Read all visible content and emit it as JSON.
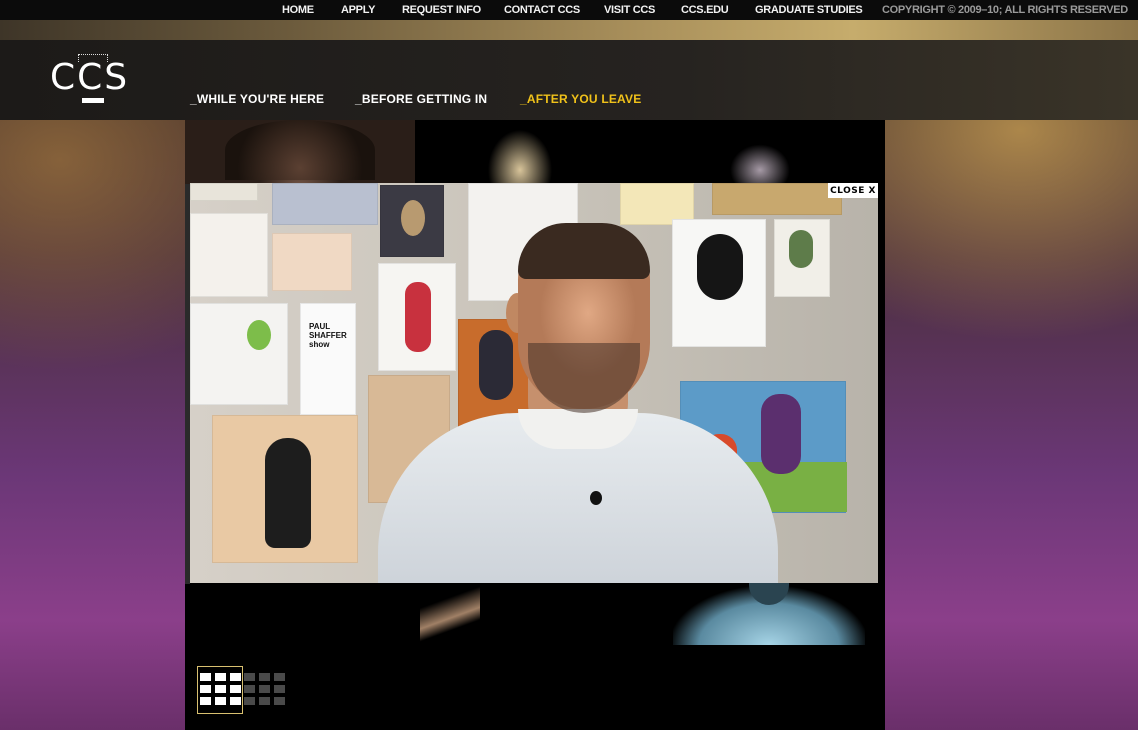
{
  "top_nav": {
    "items": [
      "HOME",
      "APPLY",
      "REQUEST INFO",
      "CONTACT CCS",
      "VISIT CCS",
      "CCS.EDU",
      "GRADUATE STUDIES"
    ],
    "copyright": "COPYRIGHT © 2009–10; ALL RIGHTS RESERVED"
  },
  "logo": {
    "text": "CCS"
  },
  "main_nav": {
    "items": [
      "_WHILE YOU'RE HERE",
      "_BEFORE GETTING IN",
      "_AFTER YOU LEAVE"
    ],
    "active": "_AFTER YOU LEAVE",
    "active_color": "#f0c21a"
  },
  "video_overlay": {
    "close_label": "CLOSE X",
    "poster_text": "PAUL SHAFFER show",
    "subject_icon": "interview-video"
  },
  "grid_controls": {
    "icons": [
      "grid-view-icon",
      "grid-view-alt-icon"
    ],
    "selected": "grid-view-icon"
  },
  "colors": {
    "topbar": "#0b0b0b",
    "header": "#1c1a18",
    "accent": "#f0c21a"
  }
}
